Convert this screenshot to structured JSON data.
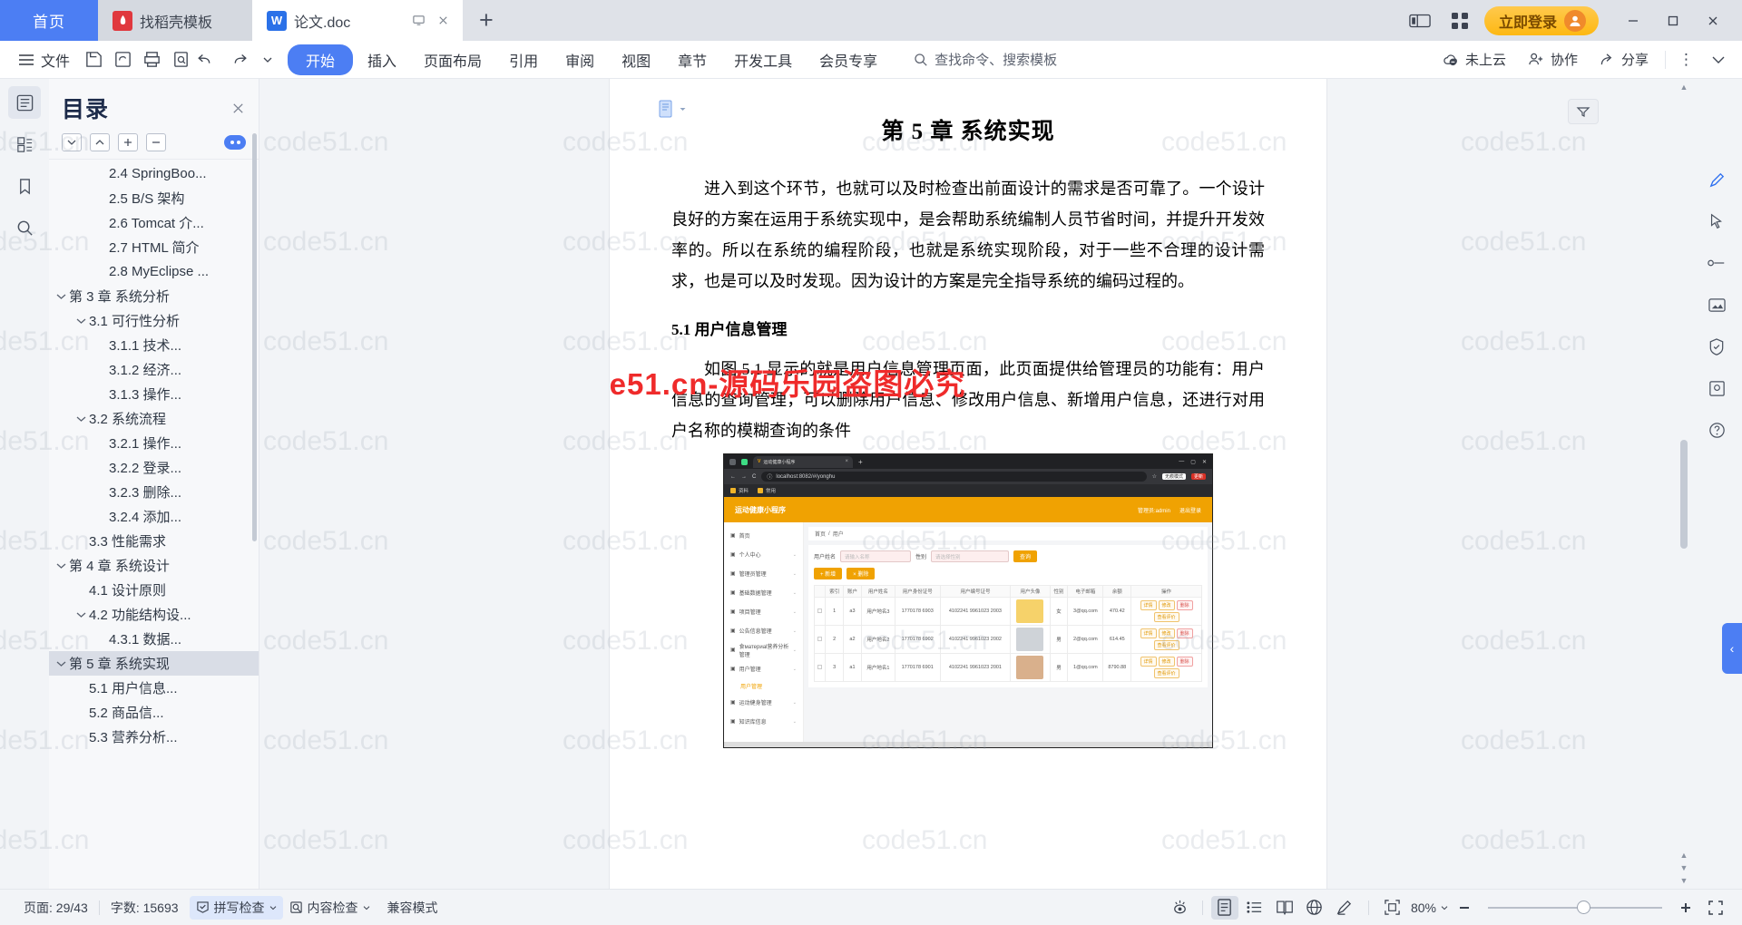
{
  "tabbar": {
    "home_label": "首页",
    "tabs": [
      {
        "label": "找稻壳模板",
        "icon": "kdocs-icon",
        "badge": "W"
      },
      {
        "label": "论文.doc",
        "icon": "wps-writer-icon",
        "badge": "W"
      }
    ],
    "new_tab_label": "+",
    "login_label": "立即登录",
    "window": {
      "minimize": "—",
      "maximize": "▢",
      "close": "✕"
    }
  },
  "ribbon": {
    "file_label": "文件",
    "tabs": [
      {
        "label": "开始",
        "active": true
      },
      {
        "label": "插入",
        "active": false
      },
      {
        "label": "页面布局",
        "active": false
      },
      {
        "label": "引用",
        "active": false
      },
      {
        "label": "审阅",
        "active": false
      },
      {
        "label": "视图",
        "active": false
      },
      {
        "label": "章节",
        "active": false
      },
      {
        "label": "开发工具",
        "active": false
      },
      {
        "label": "会员专享",
        "active": false
      }
    ],
    "search_placeholder": "查找命令、搜索模板",
    "right_items": [
      {
        "label": "未上云",
        "icon": "cloud-icon"
      },
      {
        "label": "协作",
        "icon": "collaborate-icon"
      },
      {
        "label": "分享",
        "icon": "share-icon"
      }
    ]
  },
  "toc": {
    "title": "目录",
    "tools": [
      "expand-down",
      "collapse-up",
      "plus",
      "minus"
    ],
    "items": [
      {
        "label": "2.4 SpringBoo...",
        "indent": 2,
        "chev": ""
      },
      {
        "label": "2.5 B/S 架构",
        "indent": 2,
        "chev": ""
      },
      {
        "label": "2.6 Tomcat 介...",
        "indent": 2,
        "chev": ""
      },
      {
        "label": "2.7 HTML 简介",
        "indent": 2,
        "chev": ""
      },
      {
        "label": "2.8 MyEclipse ...",
        "indent": 2,
        "chev": ""
      },
      {
        "label": "第 3 章 系统分析",
        "indent": 0,
        "chev": "v"
      },
      {
        "label": "3.1 可行性分析",
        "indent": 1,
        "chev": "v"
      },
      {
        "label": "3.1.1 技术...",
        "indent": 2,
        "chev": ""
      },
      {
        "label": "3.1.2 经济...",
        "indent": 2,
        "chev": ""
      },
      {
        "label": "3.1.3 操作...",
        "indent": 2,
        "chev": ""
      },
      {
        "label": "3.2 系统流程",
        "indent": 1,
        "chev": "v"
      },
      {
        "label": "3.2.1 操作...",
        "indent": 2,
        "chev": ""
      },
      {
        "label": "3.2.2 登录...",
        "indent": 2,
        "chev": ""
      },
      {
        "label": "3.2.3 删除...",
        "indent": 2,
        "chev": ""
      },
      {
        "label": "3.2.4 添加...",
        "indent": 2,
        "chev": ""
      },
      {
        "label": "3.3 性能需求",
        "indent": 1,
        "chev": ""
      },
      {
        "label": "第 4 章 系统设计",
        "indent": 0,
        "chev": "v"
      },
      {
        "label": "4.1 设计原则",
        "indent": 1,
        "chev": ""
      },
      {
        "label": "4.2 功能结构设...",
        "indent": 1,
        "chev": "v"
      },
      {
        "label": "4.3.1 数据...",
        "indent": 2,
        "chev": ""
      },
      {
        "label": "第 5 章 系统实现",
        "indent": 0,
        "chev": "v",
        "selected": true
      },
      {
        "label": "5.1 用户信息...",
        "indent": 1,
        "chev": ""
      },
      {
        "label": "5.2 商品信...",
        "indent": 1,
        "chev": ""
      },
      {
        "label": "5.3 营养分析...",
        "indent": 1,
        "chev": ""
      }
    ]
  },
  "document": {
    "title": "第 5 章 系统实现",
    "paragraph1": "进入到这个环节，也就可以及时检查出前面设计的需求是否可靠了。一个设计良好的方案在运用于系统实现中，是会帮助系统编制人员节省时间，并提升开发效率的。所以在系统的编程阶段，也就是系统实现阶段，对于一些不合理的设计需求，也是可以及时发现。因为设计的方案是完全指导系统的编码过程的。",
    "heading_5_1": "5.1 用户信息管理",
    "paragraph2": "如图 5.1 显示的就是用户信息管理页面，此页面提供给管理员的功能有：用户信息的查询管理，可以删除用户信息、修改用户信息、新增用户信息，还进行对用户名称的模糊查询的条件"
  },
  "watermark": {
    "text": "code51.cn",
    "red_text": "code51.cn-源码乐园盗图必究"
  },
  "figure": {
    "browser": {
      "tab_title": "运动健康小程序",
      "tab_close": "×",
      "new_tab": "+",
      "url": "localhost:8082/#/yonghu",
      "bookmarks": [
        "资料",
        "常用"
      ]
    },
    "app": {
      "brand": "运动健康小程序",
      "user_label": "管理员:admin",
      "logout_label": "退出登录",
      "breadcrumb": [
        "首页",
        "用户"
      ],
      "menu": [
        {
          "label": "首页",
          "icon": "home-icon",
          "arrow": ""
        },
        {
          "label": "个人中心",
          "icon": "user-icon",
          "arrow": "v"
        },
        {
          "label": "管理员管理",
          "icon": "admin-icon",
          "arrow": "v"
        },
        {
          "label": "基础数据管理",
          "icon": "data-icon",
          "arrow": "v"
        },
        {
          "label": "项目管理",
          "icon": "project-icon",
          "arrow": "v"
        },
        {
          "label": "公告信息管理",
          "icon": "notice-icon",
          "arrow": "v"
        },
        {
          "label": "食материal营养分析管理",
          "icon": "food-icon",
          "arrow": "v"
        },
        {
          "label": "用户管理",
          "icon": "users-icon",
          "arrow": "v"
        },
        {
          "label": "用户管理",
          "icon": "",
          "arrow": "",
          "sub": true
        },
        {
          "label": "运动健身管理",
          "icon": "sport-icon",
          "arrow": "v"
        },
        {
          "label": "知识库信息",
          "icon": "kb-icon",
          "arrow": "v"
        }
      ],
      "filter": {
        "field_label": "用户姓名",
        "input_placeholder": "请输入名称",
        "status_label": "性别",
        "select_placeholder": "请选择性别",
        "search_button": "查询"
      },
      "actions": [
        {
          "label": "+ 新增",
          "type": "primary"
        },
        {
          "label": "× 删除",
          "type": "danger"
        }
      ],
      "table": {
        "columns": [
          "",
          "索引",
          "账户",
          "用户姓名",
          "用户身份证号",
          "用户编号证号",
          "用户头像",
          "性别",
          "电子邮箱",
          "余额",
          "操作"
        ],
        "rows": [
          {
            "index": "1",
            "account": "a3",
            "name": "用户地名3",
            "idno": "1770178 6903",
            "code": "4102241 9961023 2003",
            "gender": "女",
            "email": "3@qq.com",
            "balance": "470.42"
          },
          {
            "index": "2",
            "account": "a2",
            "name": "用户地名2",
            "idno": "1770178 6902",
            "code": "4102241 9961023 2002",
            "gender": "男",
            "email": "2@qq.com",
            "balance": "614.45"
          },
          {
            "index": "3",
            "account": "a1",
            "name": "用户地名1",
            "idno": "1770178 6901",
            "code": "4102241 9961023 2001",
            "gender": "男",
            "email": "1@qq.com",
            "balance": "8790.88"
          }
        ],
        "row_actions": [
          "详情",
          "修改",
          "删除",
          "查看评价"
        ]
      }
    }
  },
  "status": {
    "page_label": "页面: 29/43",
    "word_count_label": "字数: 15693",
    "spell_check_label": "拼写检查",
    "content_check_label": "内容检查",
    "compat_label": "兼容模式",
    "zoom_label": "80%",
    "zoom_out": "−",
    "zoom_in": "+",
    "view_modes": [
      "page-view-icon",
      "outline-view-icon",
      "read-view-icon",
      "web-view-icon",
      "ink-view-icon"
    ]
  }
}
